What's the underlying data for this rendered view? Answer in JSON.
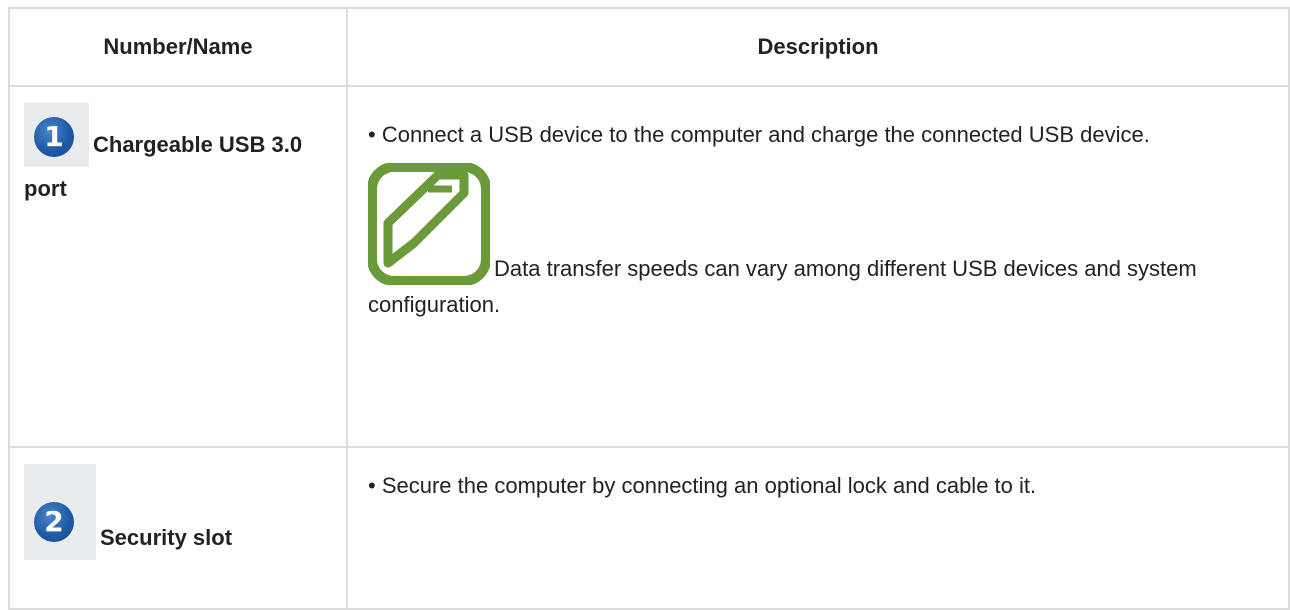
{
  "table": {
    "headers": [
      "Number/Name",
      "Description"
    ],
    "rows": [
      {
        "badge": "1",
        "name": "Chargeable USB 3.0 port",
        "description": "• Connect a USB device to the computer and charge the connected USB device.",
        "note": "Data transfer speeds can vary among different USB devices and system configuration."
      },
      {
        "badge": "2",
        "name": "Security slot",
        "description": "• Secure the computer by connecting an optional lock and cable to it."
      }
    ]
  },
  "colors": {
    "border": "#dcdcdc",
    "badge_blue": "#1f5aa6",
    "note_green": "#6a9a3a"
  },
  "icons": {
    "badge": "numbered-circle-icon",
    "note": "note-pencil-icon"
  }
}
